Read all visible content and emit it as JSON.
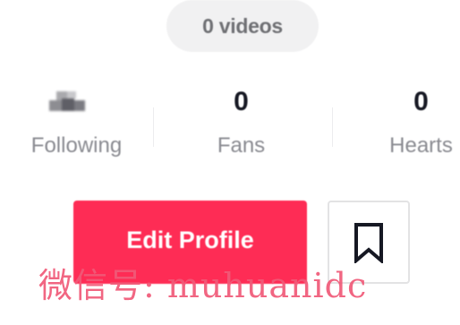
{
  "profile": {
    "videos_label": "0 videos",
    "stats": [
      {
        "value": "",
        "label": "Following"
      },
      {
        "value": "0",
        "label": "Fans"
      },
      {
        "value": "0",
        "label": "Hearts"
      }
    ],
    "edit_profile_label": "Edit Profile",
    "bookmark_icon": "bookmark-icon"
  },
  "watermark": {
    "text": "微信号: muhuanidc"
  },
  "colors": {
    "accent": "#fe2c55",
    "text_primary": "#161823",
    "text_secondary": "#8a8b91",
    "watermark": "#f05a78"
  }
}
